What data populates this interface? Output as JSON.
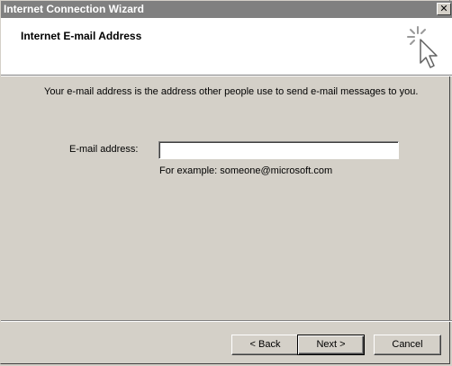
{
  "window": {
    "title": "Internet Connection Wizard",
    "close_glyph": "✕"
  },
  "header": {
    "title": "Internet E-mail Address",
    "icon": "wizard-cursor-sparkle-icon"
  },
  "main": {
    "description": "Your e-mail address is the address other people use to send e-mail messages to you.",
    "email_label": "E-mail address:",
    "email_value": "",
    "example_text": "For example: someone@microsoft.com"
  },
  "footer": {
    "back_label": "< Back",
    "next_label": "Next >",
    "cancel_label": "Cancel"
  }
}
